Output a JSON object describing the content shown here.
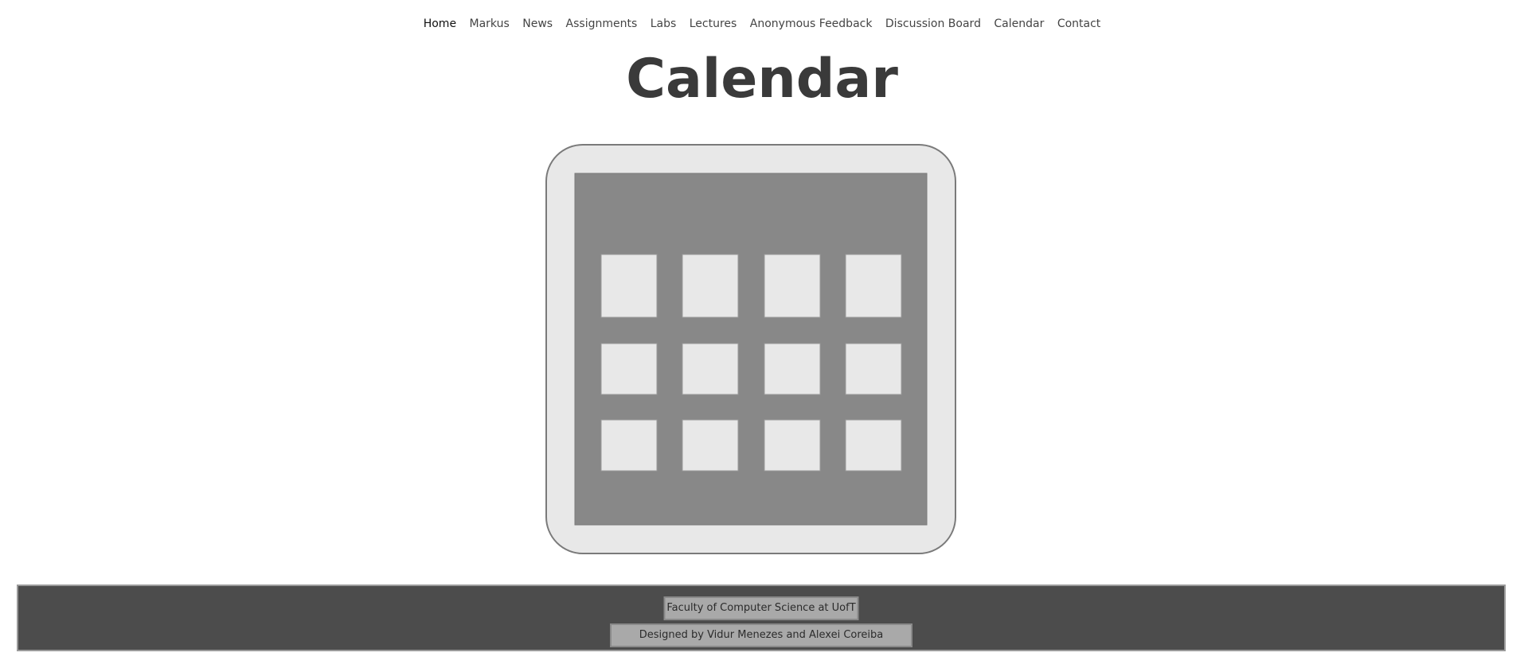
{
  "nav": {
    "items": [
      {
        "label": "Home",
        "active": true
      },
      {
        "label": "Markus",
        "active": false
      },
      {
        "label": "News",
        "active": false
      },
      {
        "label": "Assignments",
        "active": false
      },
      {
        "label": "Labs",
        "active": false
      },
      {
        "label": "Lectures",
        "active": false
      },
      {
        "label": "Anonymous Feedback",
        "active": false
      },
      {
        "label": "Discussion Board",
        "active": false
      },
      {
        "label": "Calendar",
        "active": false
      },
      {
        "label": "Contact",
        "active": false
      }
    ]
  },
  "page": {
    "title": "Calendar"
  },
  "calendar_graphic": {
    "icon": "calendar-icon",
    "rows": 3,
    "columns": 4,
    "colors": {
      "outer": "#e8e8e8",
      "outline": "#7a7a7a",
      "inner": "#888888",
      "cell": "#e8e8e8"
    }
  },
  "footer": {
    "line1": "Faculty of Computer Science at UofT",
    "line2": "Designed by Vidur Menezes and Alexei Coreiba",
    "colors": {
      "background": "#4c4c4c",
      "box": "#a9a9a9"
    }
  }
}
